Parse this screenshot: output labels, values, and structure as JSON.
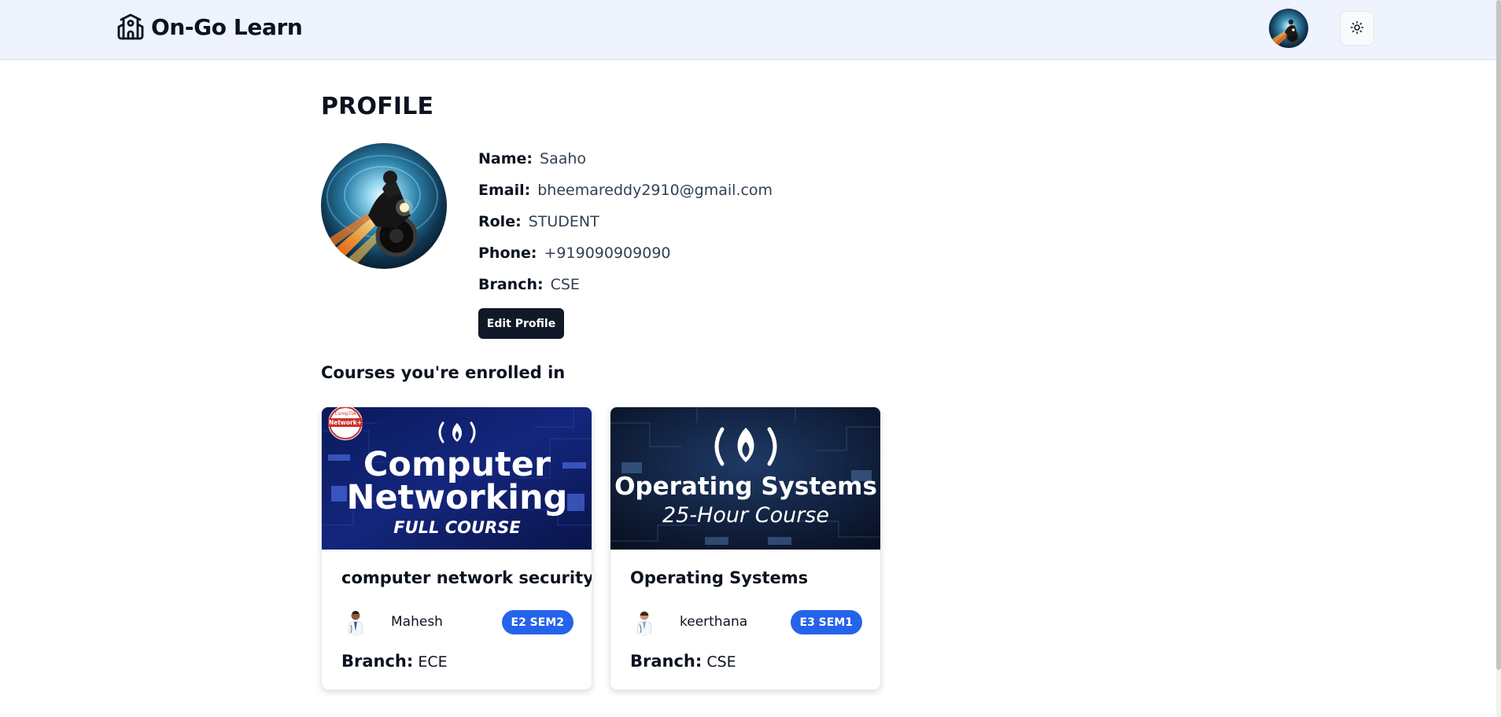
{
  "header": {
    "brand_name": "On-Go Learn",
    "logo_icon": "school-building-icon",
    "theme_toggle_icon": "sun-icon"
  },
  "profile": {
    "title": "PROFILE",
    "fields": [
      {
        "label": "Name:",
        "value": "Saaho"
      },
      {
        "label": "Email:",
        "value": "bheemareddy2910@gmail.com"
      },
      {
        "label": "Role:",
        "value": "STUDENT"
      },
      {
        "label": "Phone:",
        "value": "+919090909090"
      },
      {
        "label": "Branch:",
        "value": "CSE"
      }
    ],
    "edit_button_label": "Edit Profile"
  },
  "courses": {
    "section_title": "Courses you're enrolled in",
    "items": [
      {
        "title": "computer network security",
        "thumbnail": {
          "badge_line1": "CompTIA",
          "badge_line2": "Network+",
          "line1": "Computer",
          "line2": "Networking",
          "line3": "FULL COURSE"
        },
        "instructor": "Mahesh",
        "badge": "E2 SEM2",
        "branch_label": "Branch:",
        "branch": "ECE"
      },
      {
        "title": "Operating Systems",
        "thumbnail": {
          "line1": "Operating Systems",
          "line2": "25-Hour Course"
        },
        "instructor": "keerthana",
        "badge": "E3 SEM1",
        "branch_label": "Branch:",
        "branch": "CSE"
      }
    ]
  },
  "colors": {
    "header_bg": "#eef3fd",
    "primary_button": "#111827",
    "badge": "#2563eb"
  }
}
